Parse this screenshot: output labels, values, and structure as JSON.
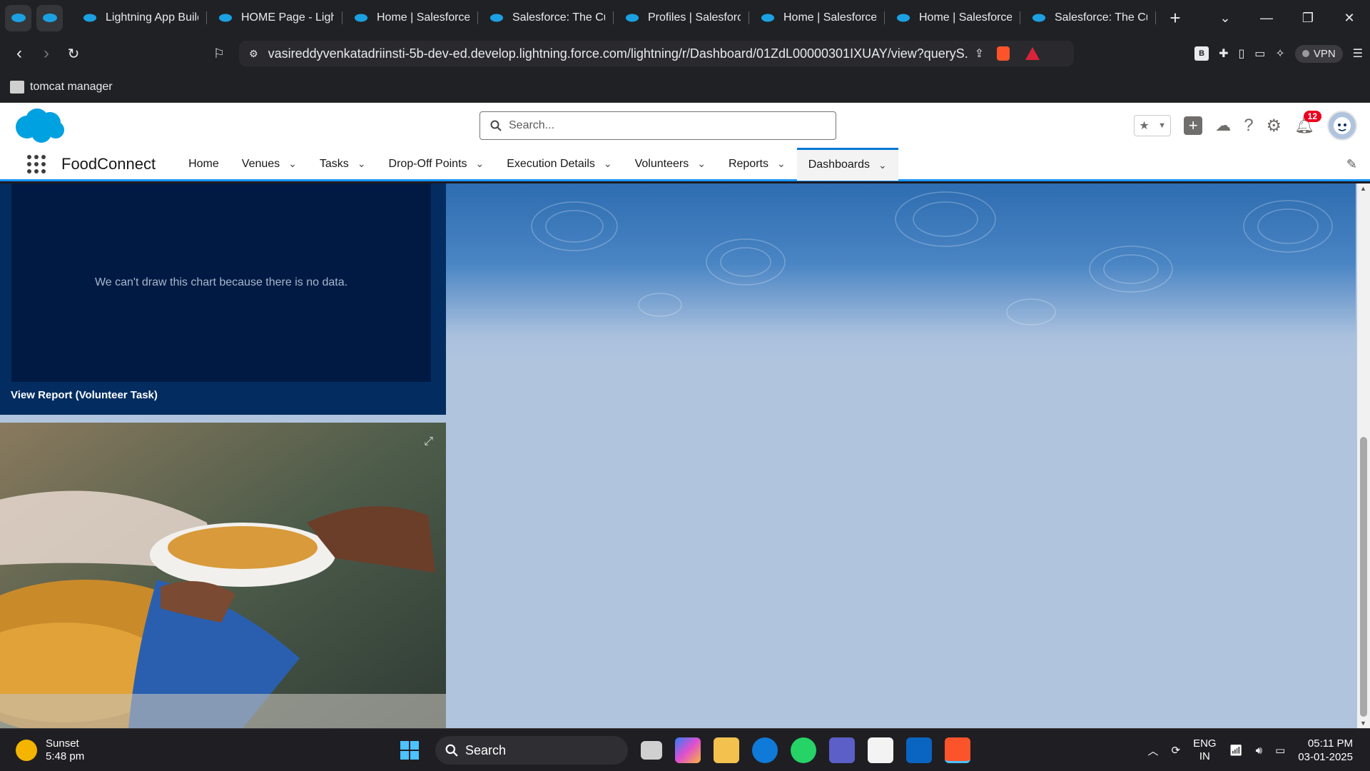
{
  "browser": {
    "tabs": [
      {
        "title": "Lightning App Builder"
      },
      {
        "title": "HOME Page - Lightning"
      },
      {
        "title": "Home | Salesforce"
      },
      {
        "title": "Salesforce: The Customer"
      },
      {
        "title": "Profiles | Salesforce"
      },
      {
        "title": "Home | Salesforce"
      },
      {
        "title": "Home | Salesforce"
      },
      {
        "title": "Salesforce: The Customer"
      }
    ],
    "url": "vasireddyvenkatadriinsti-5b-dev-ed.develop.lightning.force.com/lightning/r/Dashboard/01ZdL00000301IXUAY/view?queryS...",
    "vpn_label": "VPN",
    "bookmark": "tomcat manager"
  },
  "salesforce": {
    "search_placeholder": "Search...",
    "notification_count": "12",
    "app_name": "FoodConnect",
    "nav": [
      {
        "label": "Home",
        "dropdown": false
      },
      {
        "label": "Venues",
        "dropdown": true
      },
      {
        "label": "Tasks",
        "dropdown": true
      },
      {
        "label": "Drop-Off Points",
        "dropdown": true
      },
      {
        "label": "Execution Details",
        "dropdown": true
      },
      {
        "label": "Volunteers",
        "dropdown": true
      },
      {
        "label": "Reports",
        "dropdown": true
      },
      {
        "label": "Dashboards",
        "dropdown": true,
        "active": true
      }
    ]
  },
  "dashboard": {
    "no_data_message": "We can't draw this chart because there is no data.",
    "view_report_link": "View Report (Volunteer Task)"
  },
  "taskbar": {
    "weather_title": "Sunset",
    "weather_time": "5:48 pm",
    "search_label": "Search",
    "lang_line1": "ENG",
    "lang_line2": "IN",
    "time": "05:11 PM",
    "date": "03-01-2025"
  },
  "colors": {
    "sf_blue": "#0176d3",
    "dashboard_bg": "#b0c4de",
    "card_dark": "#032d60"
  }
}
